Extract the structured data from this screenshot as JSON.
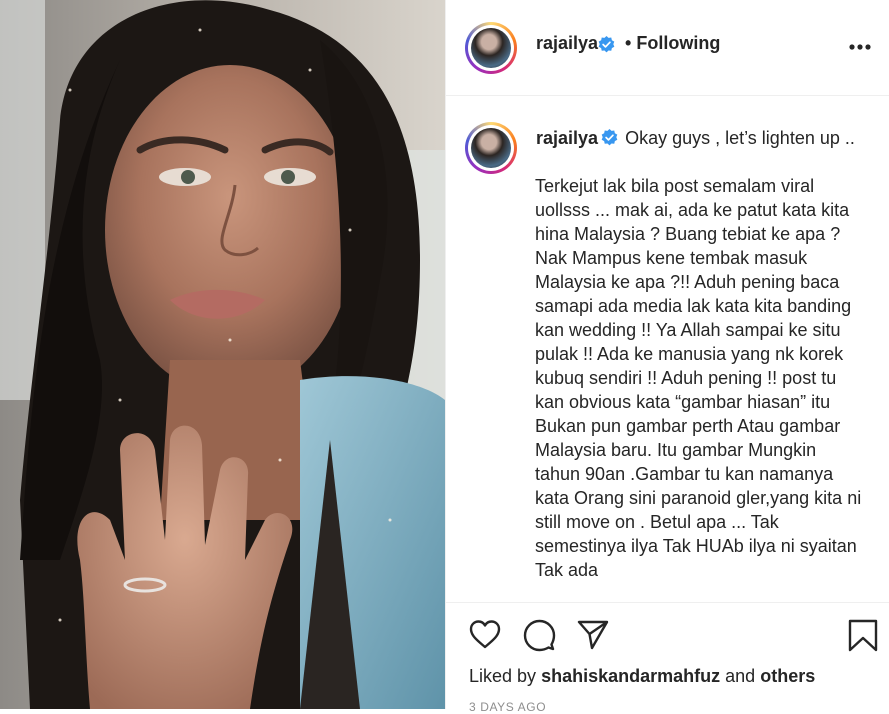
{
  "post": {
    "username": "rajailya",
    "follow_separator": "•",
    "follow_status": "Following",
    "caption_lead": "Okay guys , let’s lighten up ..",
    "caption_body": "Terkejut lak bila post semalam viral uollsss ... mak ai, ada ke patut kata kita hina Malaysia ? Buang tebiat ke apa ? Nak Mampus kene tembak masuk Malaysia ke apa ?!! Aduh pening baca samapi ada media lak kata kita banding kan wedding !! Ya Allah sampai ke situ pulak !! Ada ke manusia yang nk korek kubuq sendiri !! Aduh pening !! post tu kan obvious kata “gambar hiasan” itu Bukan pun gambar perth Atau gambar Malaysia baru. Itu gambar Mungkin tahun 90an .Gambar tu kan namanya kata Orang sini paranoid gler,yang kita ni still move on . Betul apa ... Tak semestinya ilya Tak HUAb ilya ni syaitan Tak ada",
    "liked_by_prefix": "Liked by",
    "liked_by_user": "shahiskandarmahfuz",
    "liked_by_and": "and",
    "liked_by_others": "others",
    "timestamp": "3 DAYS AGO"
  },
  "icons": {
    "verified": "verified-badge-icon",
    "more": "more-options-icon",
    "like": "heart-icon",
    "comment": "comment-icon",
    "share": "paper-plane-icon",
    "save": "bookmark-icon"
  },
  "colors": {
    "verified_blue": "#3897f0",
    "text": "#262626",
    "muted": "#8e8e8e",
    "border": "#efefef"
  }
}
